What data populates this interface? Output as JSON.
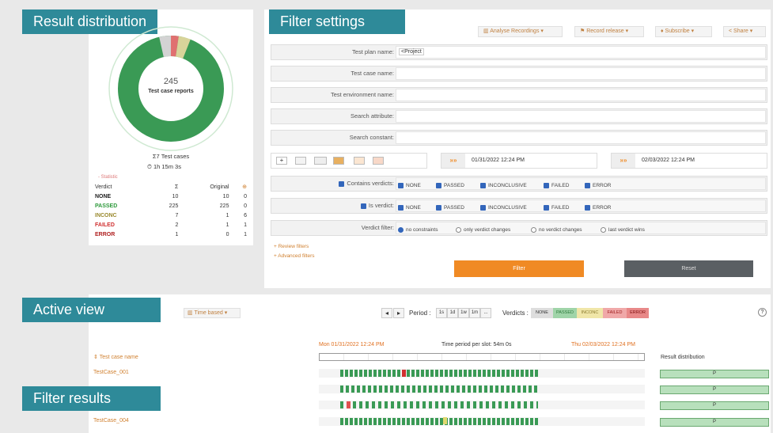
{
  "result_distribution": {
    "title": "Result distribution",
    "total": "245",
    "total_label": "Test case reports",
    "test_cases": "Σ7 Test cases",
    "duration": "1h 15m 3s",
    "statistic_link": "- Statistic",
    "table_headers": [
      "Verdict",
      "Σ",
      "Original",
      "⊕"
    ],
    "rows": [
      {
        "verdict": "NONE",
        "sum": "10",
        "original": "10",
        "extra": "0",
        "color": "#222222"
      },
      {
        "verdict": "PASSED",
        "sum": "225",
        "original": "225",
        "extra": "0",
        "color": "#2e9a3c"
      },
      {
        "verdict": "INCONC",
        "sum": "7",
        "original": "1",
        "extra": "6",
        "color": "#9a8a2e"
      },
      {
        "verdict": "FAILED",
        "sum": "2",
        "original": "1",
        "extra": "1",
        "color": "#d03030"
      },
      {
        "verdict": "ERROR",
        "sum": "1",
        "original": "0",
        "extra": "1",
        "color": "#b02020"
      }
    ]
  },
  "filter_settings": {
    "title": "Filter settings",
    "toolbar": [
      "Analyse Recordings",
      "Record release",
      "Subscribe",
      "Share"
    ],
    "fields": [
      {
        "label": "Test plan name:",
        "value": "<Project"
      },
      {
        "label": "Test case name:",
        "value": ""
      },
      {
        "label": "Test environment name:",
        "value": ""
      },
      {
        "label": "Search attribute:",
        "value": ""
      },
      {
        "label": "Search constant:",
        "value": ""
      }
    ],
    "date_from": "01/31/2022 12:24 PM",
    "date_to": "02/03/2022 12:24 PM",
    "contains_verdicts_label": "Contains verdicts:",
    "is_verdict_label": "Is verdict:",
    "verdict_options": [
      "NONE",
      "PASSED",
      "INCONCLUSIVE",
      "FAILED",
      "ERROR"
    ],
    "verdict_filter_label": "Verdict filter:",
    "verdict_filter_options": [
      "no constraints",
      "only verdict changes",
      "no verdict changes",
      "last verdict wins"
    ],
    "review_filters": "+ Review filters",
    "advanced_filters": "+ Advanced filters",
    "filter_button": "Filter",
    "reset_button": "Reset"
  },
  "active_view": {
    "title": "Active view",
    "mode": "Time based",
    "period_label": "Period :",
    "period_options": [
      "1s",
      "1d",
      "1w",
      "1m",
      "..."
    ],
    "verdicts_label": "Verdicts :",
    "verdict_chips": [
      "NONE",
      "PASSED",
      "INCONC",
      "FAILED",
      "ERROR"
    ],
    "start": "Mon 01/31/2022 12:24 PM",
    "period_per_slot": "Time period per slot: 54m 0s",
    "end": "Thu 02/03/2022 12:24 PM",
    "column_test_case": "Test case name",
    "column_result": "Result distribution"
  },
  "filter_results": {
    "title": "Filter results",
    "rows": [
      "TestCase_001",
      "",
      "",
      "TestCase_004"
    ]
  },
  "colors": {
    "teal": "#2e8a99",
    "passed": "#2e9a3c",
    "orange": "#f08a24",
    "dark_button": "#5a5f63"
  }
}
